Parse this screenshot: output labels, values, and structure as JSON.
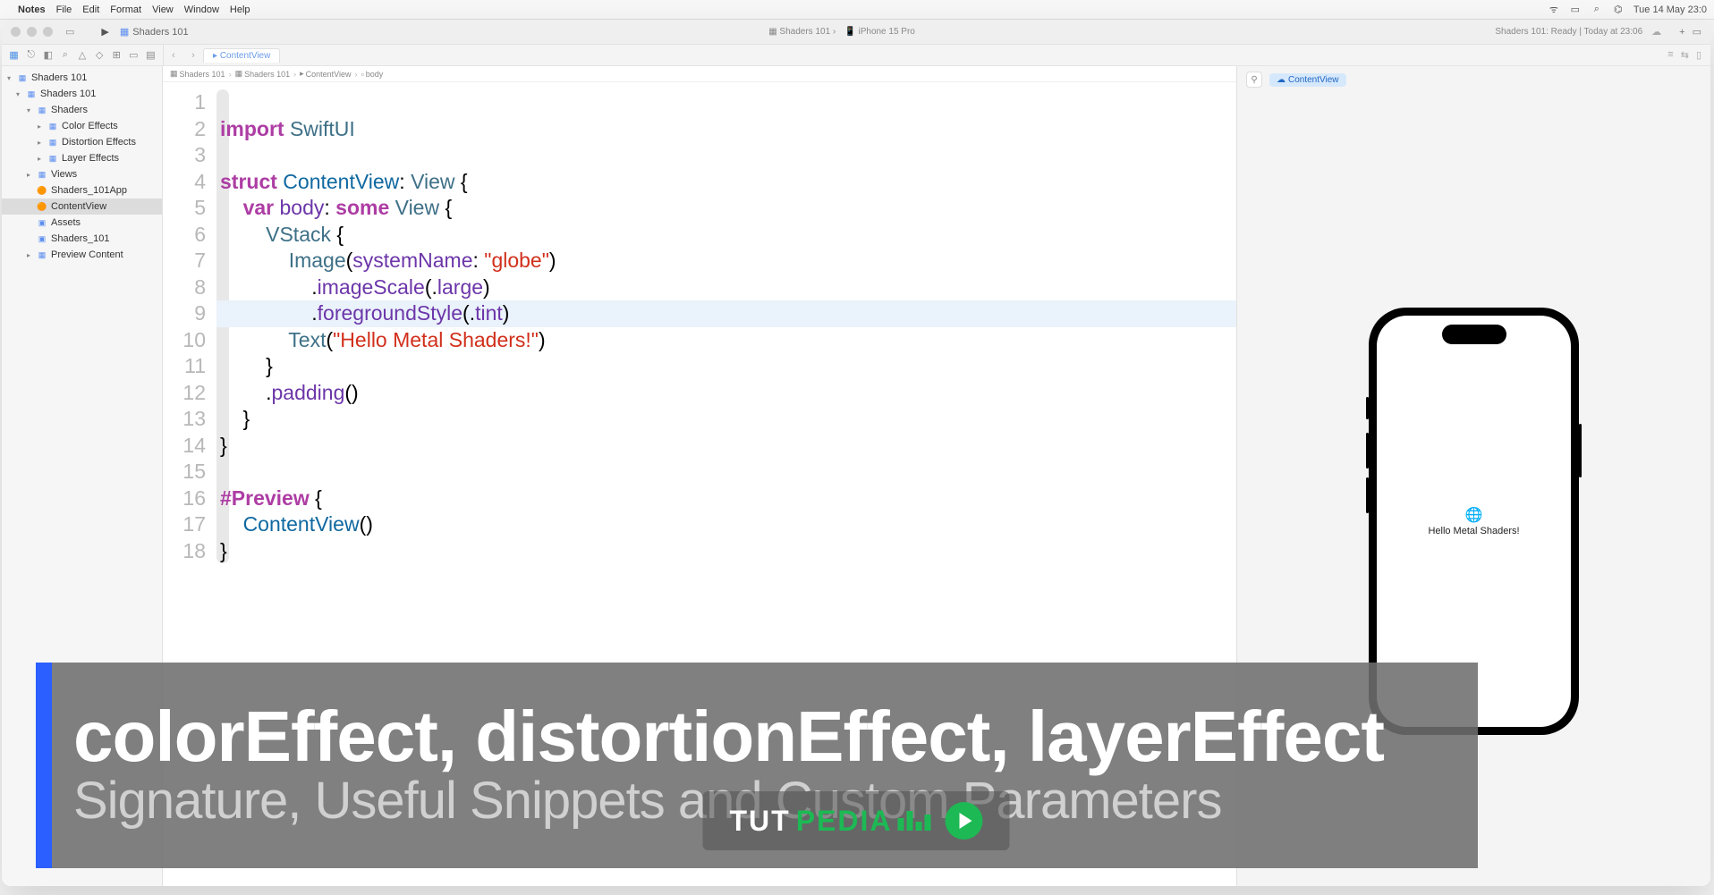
{
  "menubar": {
    "app": "Notes",
    "items": [
      "File",
      "Edit",
      "Format",
      "View",
      "Window",
      "Help"
    ],
    "clock": "Tue 14 May  23:0"
  },
  "titlebar": {
    "scheme": "Shaders 101",
    "device_tab": "Shaders 101",
    "device_tab2": "iPhone 15 Pro",
    "status": "Shaders 101: Ready | Today at 23:06"
  },
  "file_tab": "ContentView",
  "breadcrumb": [
    "Shaders 101",
    "Shaders 101",
    "ContentView",
    "body"
  ],
  "navigator": {
    "project": "Shaders 101",
    "groups": [
      {
        "label": "Shaders 101",
        "level": 1,
        "icon": "fld",
        "open": true
      },
      {
        "label": "Shaders",
        "level": 2,
        "icon": "fld",
        "open": true
      },
      {
        "label": "Color Effects",
        "level": 3,
        "icon": "fld",
        "open": false
      },
      {
        "label": "Distortion Effects",
        "level": 3,
        "icon": "fld",
        "open": false
      },
      {
        "label": "Layer Effects",
        "level": 3,
        "icon": "fld",
        "open": false
      },
      {
        "label": "Views",
        "level": 2,
        "icon": "fld",
        "open": false
      },
      {
        "label": "Shaders_101App",
        "level": 2,
        "icon": "swift"
      },
      {
        "label": "ContentView",
        "level": 2,
        "icon": "swift",
        "selected": true
      },
      {
        "label": "Assets",
        "level": 2,
        "icon": "asset"
      },
      {
        "label": "Shaders_101",
        "level": 2,
        "icon": "asset"
      },
      {
        "label": "Preview Content",
        "level": 2,
        "icon": "fld",
        "open": false
      }
    ]
  },
  "code": {
    "lines": [
      "",
      "import SwiftUI",
      "",
      "struct ContentView: View {",
      "    var body: some View {",
      "        VStack {",
      "            Image(systemName: \"globe\")",
      "                .imageScale(.large)",
      "                .foregroundStyle(.tint)",
      "            Text(\"Hello Metal Shaders!\")",
      "        }",
      "        .padding()",
      "    }",
      "}",
      "",
      "#Preview {",
      "    ContentView()",
      "}"
    ],
    "highlighted_line": 9
  },
  "canvas": {
    "chip": "ContentView",
    "preview_text": "Hello Metal Shaders!"
  },
  "banner": {
    "title": "colorEffect, distortionEffect, layerEffect",
    "subtitle": "Signature, Useful Snippets and Custom Parameters"
  },
  "watermark": {
    "part1": "TUT ",
    "part2": "PEDIA"
  }
}
